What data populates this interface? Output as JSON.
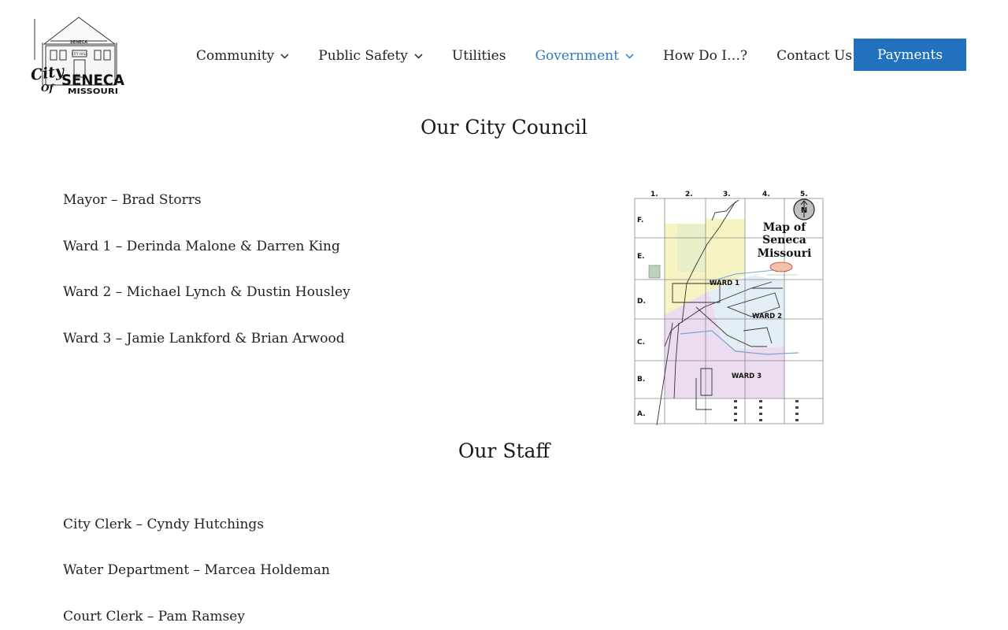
{
  "header": {
    "logo": {
      "top_text": "SENECA",
      "plaque_text": "CITY HALL",
      "city_word": "City",
      "of_word": "Of",
      "name": "SENECA",
      "state": "MISSOURI"
    },
    "nav": [
      {
        "label": "Community",
        "has_dropdown": true,
        "active": false
      },
      {
        "label": "Public Safety",
        "has_dropdown": true,
        "active": false
      },
      {
        "label": "Utilities",
        "has_dropdown": false,
        "active": false
      },
      {
        "label": "Government",
        "has_dropdown": true,
        "active": true
      },
      {
        "label": "How Do I…?",
        "has_dropdown": false,
        "active": false
      },
      {
        "label": "Contact Us",
        "has_dropdown": false,
        "active": false
      }
    ],
    "payments_label": "Payments"
  },
  "council": {
    "title": "Our City Council",
    "members": [
      "Mayor – Brad Storrs",
      "Ward 1 – Derinda Malone & Darren King",
      "Ward 2 – Michael Lynch & Dustin Housley",
      "Ward 3 – Jamie Lankford & Brian Arwood"
    ]
  },
  "map": {
    "title_lines": [
      "Map of",
      "Seneca",
      "Missouri"
    ],
    "col_labels": [
      "1.",
      "2.",
      "3.",
      "4.",
      "5."
    ],
    "row_labels": [
      "F.",
      "E.",
      "D.",
      "C.",
      "B.",
      "A."
    ],
    "ward_labels": [
      "WARD 1",
      "WARD 2",
      "WARD 3"
    ],
    "north_label": "N"
  },
  "staff": {
    "title": "Our Staff",
    "members": [
      "City Clerk – Cyndy Hutchings",
      "Water Department – Marcea Holdeman",
      "Court Clerk – Pam Ramsey"
    ]
  },
  "colors": {
    "accent": "#2f7ac4",
    "button": "#2271be",
    "ward1": "#f6f4c2",
    "ward2": "#e3eef5",
    "ward3": "#ecdcf0"
  }
}
